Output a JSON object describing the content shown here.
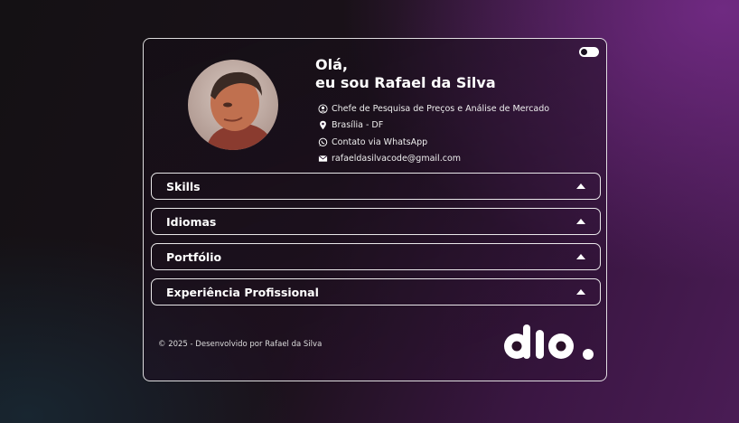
{
  "profile": {
    "greeting": "Olá,",
    "intro_prefix": "eu sou ",
    "name": "Rafael da Silva",
    "info": [
      {
        "icon": "user-circle-icon",
        "text": "Chefe de Pesquisa de Preços e Análise de Mercado"
      },
      {
        "icon": "location-pin-icon",
        "text": "Brasília - DF"
      },
      {
        "icon": "whatsapp-icon",
        "text": "Contato via WhatsApp"
      },
      {
        "icon": "envelope-icon",
        "text": "rafaeldasilvacode@gmail.com"
      }
    ]
  },
  "accordion": [
    {
      "title": "Skills"
    },
    {
      "title": "Idiomas"
    },
    {
      "title": "Portfólio"
    },
    {
      "title": "Experiência Profissional"
    }
  ],
  "footer": {
    "copyright": "© 2025 - Desenvolvido por Rafael da Silva",
    "logo_text": "dio."
  },
  "theme_toggle": {
    "state": "dark"
  }
}
